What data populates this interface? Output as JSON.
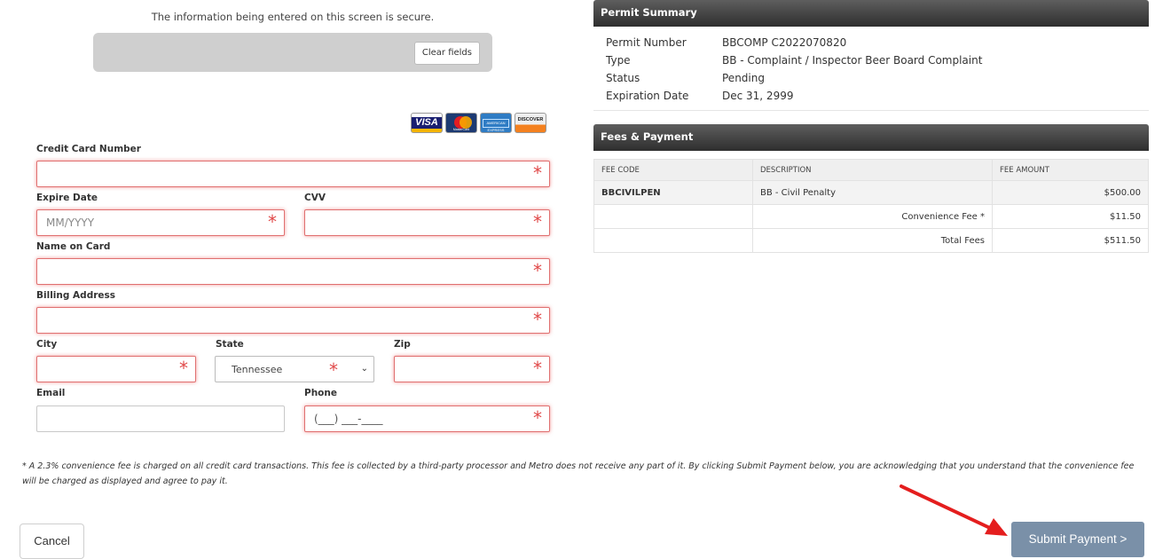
{
  "secure_note": "The information being entered on this screen is secure.",
  "clear_fields_label": "Clear fields",
  "card_logos": {
    "visa": "VISA",
    "mastercard": "MasterCard",
    "amex": "AMERICAN EXPRESS",
    "discover": "DISCOVER"
  },
  "form": {
    "card_number_label": "Credit Card Number",
    "expire_label": "Expire Date",
    "expire_placeholder": "MM/YYYY",
    "cvv_label": "CVV",
    "name_label": "Name on Card",
    "address_label": "Billing Address",
    "city_label": "City",
    "state_label": "State",
    "state_value": "Tennessee",
    "zip_label": "Zip",
    "email_label": "Email",
    "phone_label": "Phone",
    "phone_placeholder": "(___) ___-____",
    "required_marker": "*"
  },
  "permit_summary": {
    "title": "Permit Summary",
    "rows": [
      {
        "key": "Permit Number",
        "value": "BBCOMP C2022070820"
      },
      {
        "key": "Type",
        "value": "BB - Complaint / Inspector Beer Board Complaint"
      },
      {
        "key": "Status",
        "value": "Pending"
      },
      {
        "key": "Expiration Date",
        "value": "Dec 31, 2999"
      }
    ]
  },
  "fees": {
    "title": "Fees & Payment",
    "headers": [
      "FEE CODE",
      "DESCRIPTION",
      "FEE AMOUNT"
    ],
    "rows": [
      {
        "code": "BBCIVILPEN",
        "description": "BB - Civil Penalty",
        "amount": "$500.00"
      },
      {
        "code": "",
        "description": "Convenience Fee *",
        "amount": "$11.50"
      },
      {
        "code": "",
        "description": "Total Fees",
        "amount": "$511.50"
      }
    ]
  },
  "disclaimer": "* A 2.3% convenience fee is charged on all credit card transactions. This fee is collected by a third-party processor and Metro does not receive any part of it. By clicking Submit Payment below, you are acknowledging that you understand that the convenience fee will be charged as displayed and agree to pay it.",
  "cancel_label": "Cancel",
  "submit_label": "Submit Payment >",
  "colors": {
    "required": "#e04848",
    "submit": "#7a90a8",
    "header": "#3a3a3a",
    "arrow": "#e41e1e"
  }
}
